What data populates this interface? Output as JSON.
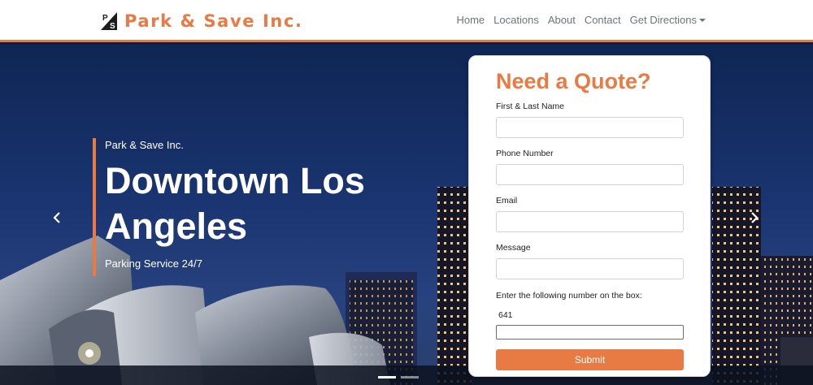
{
  "brand": {
    "logo_letters": "PS",
    "name": "Park & Save Inc."
  },
  "nav": {
    "items": [
      {
        "label": "Home"
      },
      {
        "label": "Locations"
      },
      {
        "label": "About"
      },
      {
        "label": "Contact"
      },
      {
        "label": "Get Directions"
      }
    ]
  },
  "hero": {
    "kicker": "Park & Save Inc.",
    "title": "Downtown Los Angeles",
    "subtitle": "Parking Service 24/7",
    "prev_icon": "chevron-left-icon",
    "next_icon": "chevron-right-icon",
    "slides_count": 2,
    "active_slide": 1
  },
  "quote_form": {
    "title": "Need a Quote?",
    "fields": [
      {
        "label": "First & Last Name",
        "value": ""
      },
      {
        "label": "Phone Number",
        "value": ""
      },
      {
        "label": "Email",
        "value": ""
      },
      {
        "label": "Message",
        "value": ""
      }
    ],
    "captcha_label": "Enter the following number on the box:",
    "captcha_code": "641",
    "captcha_value": "",
    "submit_label": "Submit"
  },
  "colors": {
    "accent": "#e87a43",
    "nav_text": "#6c757d",
    "sky": "#193470"
  }
}
